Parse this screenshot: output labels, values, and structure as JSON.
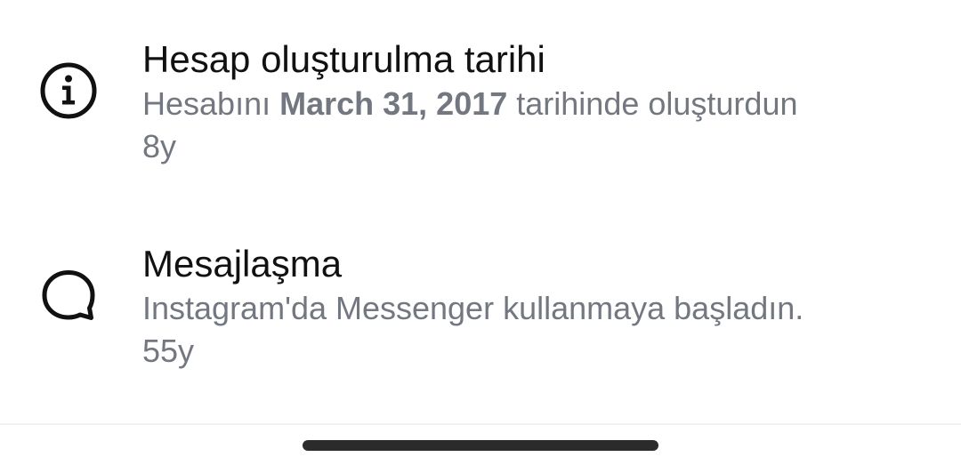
{
  "items": [
    {
      "icon": "info-icon",
      "title": "Hesap oluşturulma tarihi",
      "desc_prefix": "Hesabını ",
      "desc_bold": "March 31, 2017",
      "desc_suffix": " tarihinde oluşturdun",
      "time": "8y"
    },
    {
      "icon": "message-bubble-icon",
      "title": "Mesajlaşma",
      "desc": "Instagram'da Messenger kullanmaya başladın.",
      "time": "55y"
    }
  ],
  "colors": {
    "title": "#111111",
    "secondary": "#737780",
    "icon": "#111111",
    "home_indicator": "#2b2b2b"
  }
}
